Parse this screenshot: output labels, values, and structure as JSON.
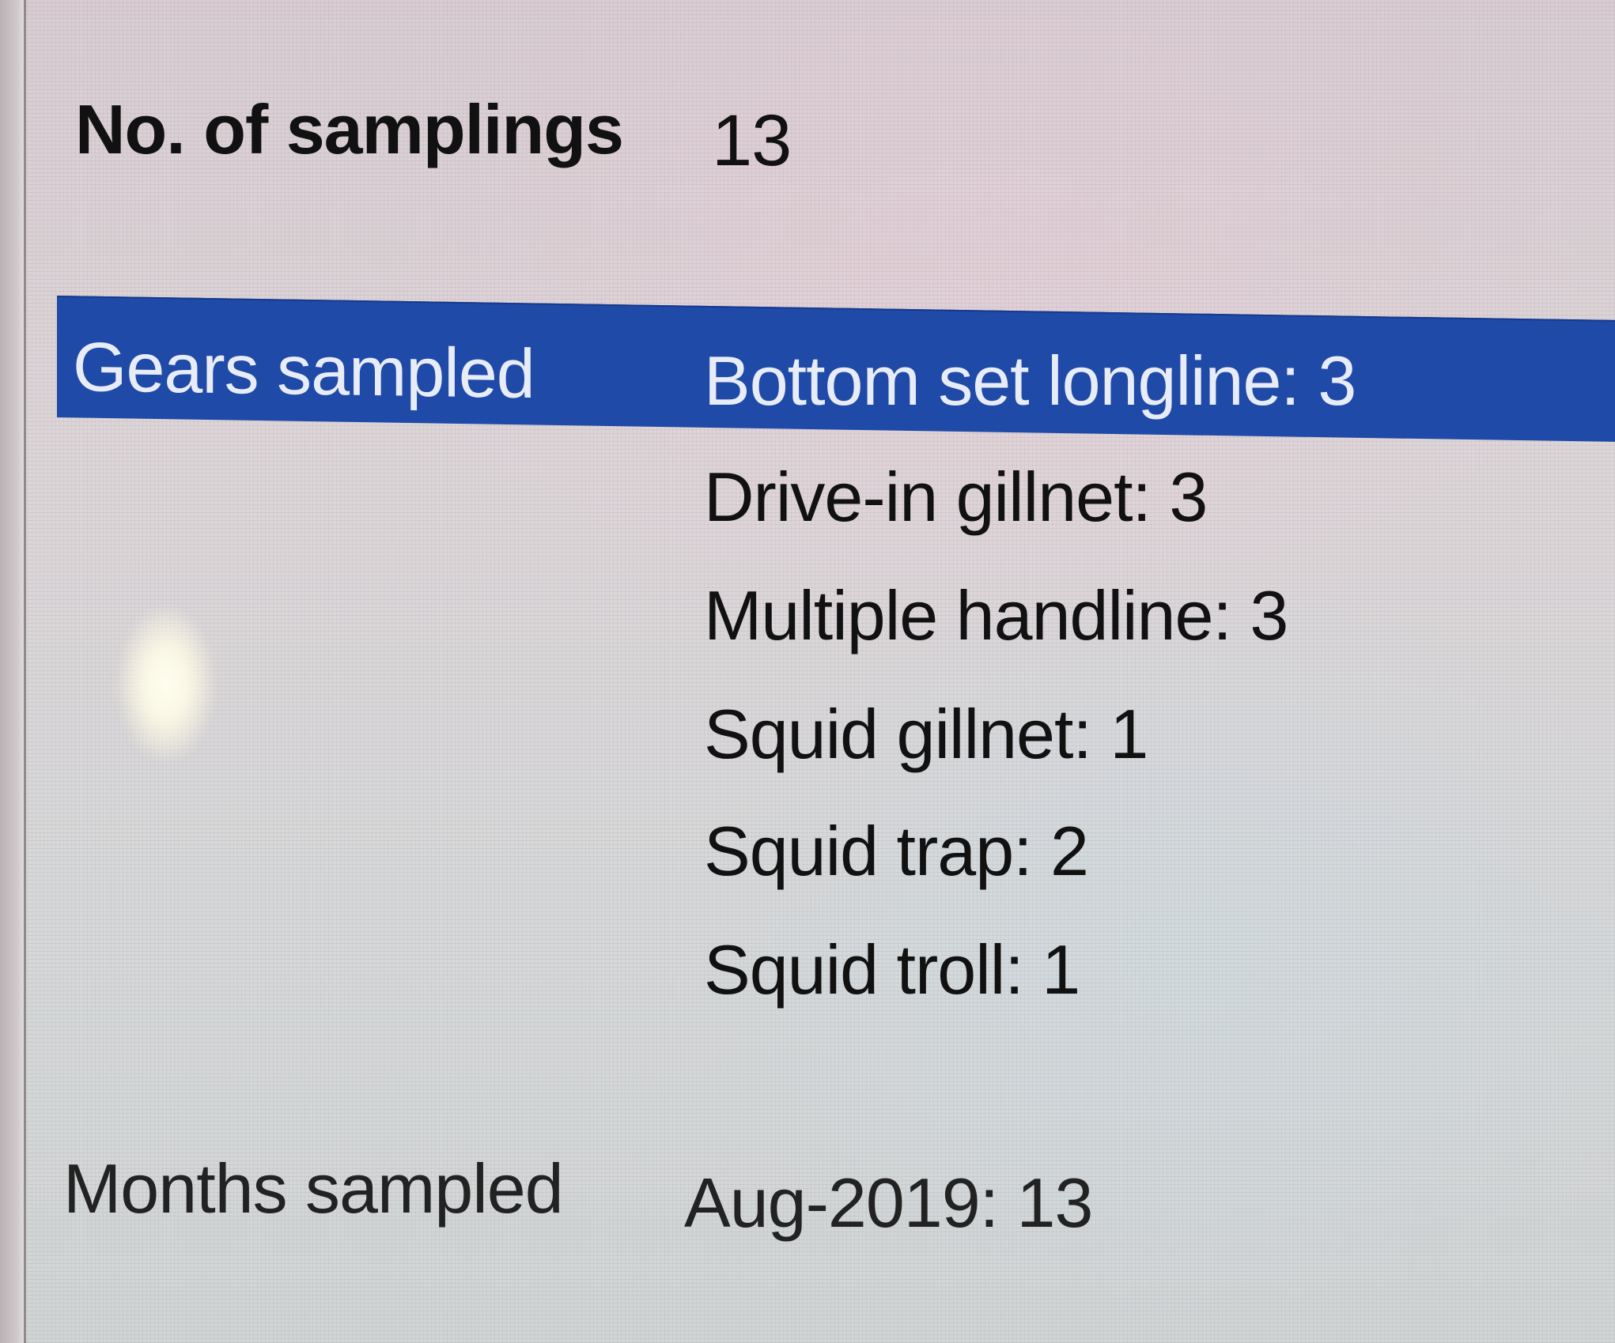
{
  "summary": {
    "samplings": {
      "label": "No. of samplings",
      "value": "13"
    },
    "gears": {
      "label": "Gears sampled",
      "items": [
        "Bottom set longline: 3",
        "Drive-in gillnet: 3",
        "Multiple handline: 3",
        "Squid gillnet: 1",
        "Squid trap: 2",
        "Squid troll: 1"
      ]
    },
    "months": {
      "label": "Months sampled",
      "value": "Aug-2019: 13"
    }
  },
  "colors": {
    "selection_highlight": "#1f4aa8",
    "text": "#111111",
    "background": "#dad6d8"
  }
}
